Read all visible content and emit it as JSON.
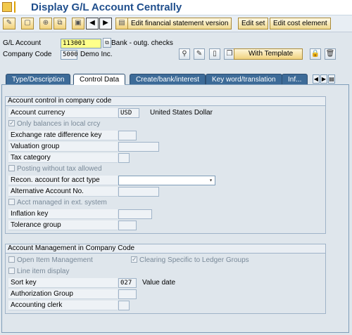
{
  "window": {
    "title": "Display G/L Account Centrally"
  },
  "toolbar": {
    "nav_prev": "◀",
    "nav_next": "▶",
    "btn_fin_stmt": "Edit financial statement version",
    "btn_edit_set": "Edit set",
    "btn_edit_cost": "Edit cost element"
  },
  "header": {
    "gl_account_label": "G/L Account",
    "gl_account_value": "113001",
    "gl_account_desc": "Bank - outg. checks",
    "company_code_label": "Company Code",
    "company_code_value": "5000",
    "company_code_desc": "Demo Inc.",
    "with_template_label": "With Template"
  },
  "tabs": [
    {
      "label": "Type/Description"
    },
    {
      "label": "Control Data"
    },
    {
      "label": "Create/bank/interest"
    },
    {
      "label": "Key word/translation"
    },
    {
      "label": "Inf..."
    }
  ],
  "group1": {
    "title": "Account control in company code",
    "account_currency_label": "Account currency",
    "account_currency_value": "USD",
    "account_currency_desc": "United States Dollar",
    "only_balances_label": "Only balances in local crcy",
    "exchange_rate_label": "Exchange rate difference key",
    "valuation_group_label": "Valuation group",
    "tax_category_label": "Tax category",
    "posting_without_tax_label": "Posting without tax allowed",
    "recon_account_label": "Recon. account for acct type",
    "alt_account_label": "Alternative Account No.",
    "acct_managed_label": "Acct managed in ext. system",
    "inflation_key_label": "Inflation key",
    "tolerance_group_label": "Tolerance group"
  },
  "group2": {
    "title": "Account Management in Company Code",
    "open_item_label": "Open Item Management",
    "clearing_specific_label": "Clearing Specific to Ledger Groups",
    "line_item_label": "Line item display",
    "sort_key_label": "Sort key",
    "sort_key_value": "027",
    "sort_key_desc": "Value date",
    "auth_group_label": "Authorization Group",
    "acct_clerk_label": "Accounting clerk"
  }
}
